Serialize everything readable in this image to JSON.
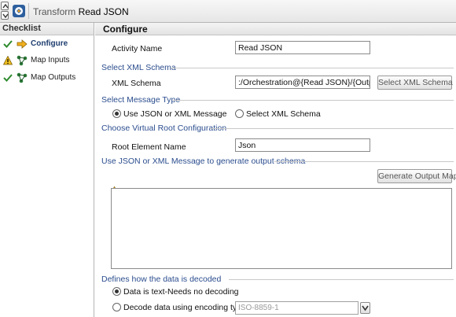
{
  "window": {
    "title_prefix": "Transform",
    "title_name": "Read JSON"
  },
  "sidebar": {
    "header": "Checklist",
    "items": [
      {
        "label": "Configure",
        "status": "check",
        "active": true
      },
      {
        "label": "Map Inputs",
        "status": "warning",
        "active": false
      },
      {
        "label": "Map Outputs",
        "status": "check",
        "active": false
      }
    ]
  },
  "main": {
    "title": "Configure",
    "activity_name": {
      "label": "Activity Name",
      "value": "Read JSON"
    },
    "schema_section": "Select XML Schema",
    "xml_schema": {
      "label": "XML Schema",
      "value": ":/Orchestration@{Read JSON}/{OutputXml}",
      "button": "Select XML Schema"
    },
    "message_type_section": "Select Message Type",
    "message_type_options": [
      {
        "label": "Use JSON or XML Message",
        "selected": true
      },
      {
        "label": "Select XML Schema",
        "selected": false
      }
    ],
    "virtual_root_section": "Choose Virtual Root Configuration",
    "root_element": {
      "label": "Root Element Name",
      "value": "Json"
    },
    "generate_section": "Use JSON or XML Message to generate output schema",
    "generate_button": "Generate Output Map",
    "message_text": "",
    "decode_section": "Defines how the data is decoded",
    "decode_options": [
      {
        "label": "Data is text-Needs no decoding",
        "selected": true
      },
      {
        "label": "Decode data using encoding type:",
        "selected": false
      }
    ],
    "encoding_value": "ISO-8859-1"
  },
  "colors": {
    "section_text": "#2b4d8e",
    "check": "#2e8b2e",
    "warning": "#f0c020"
  }
}
